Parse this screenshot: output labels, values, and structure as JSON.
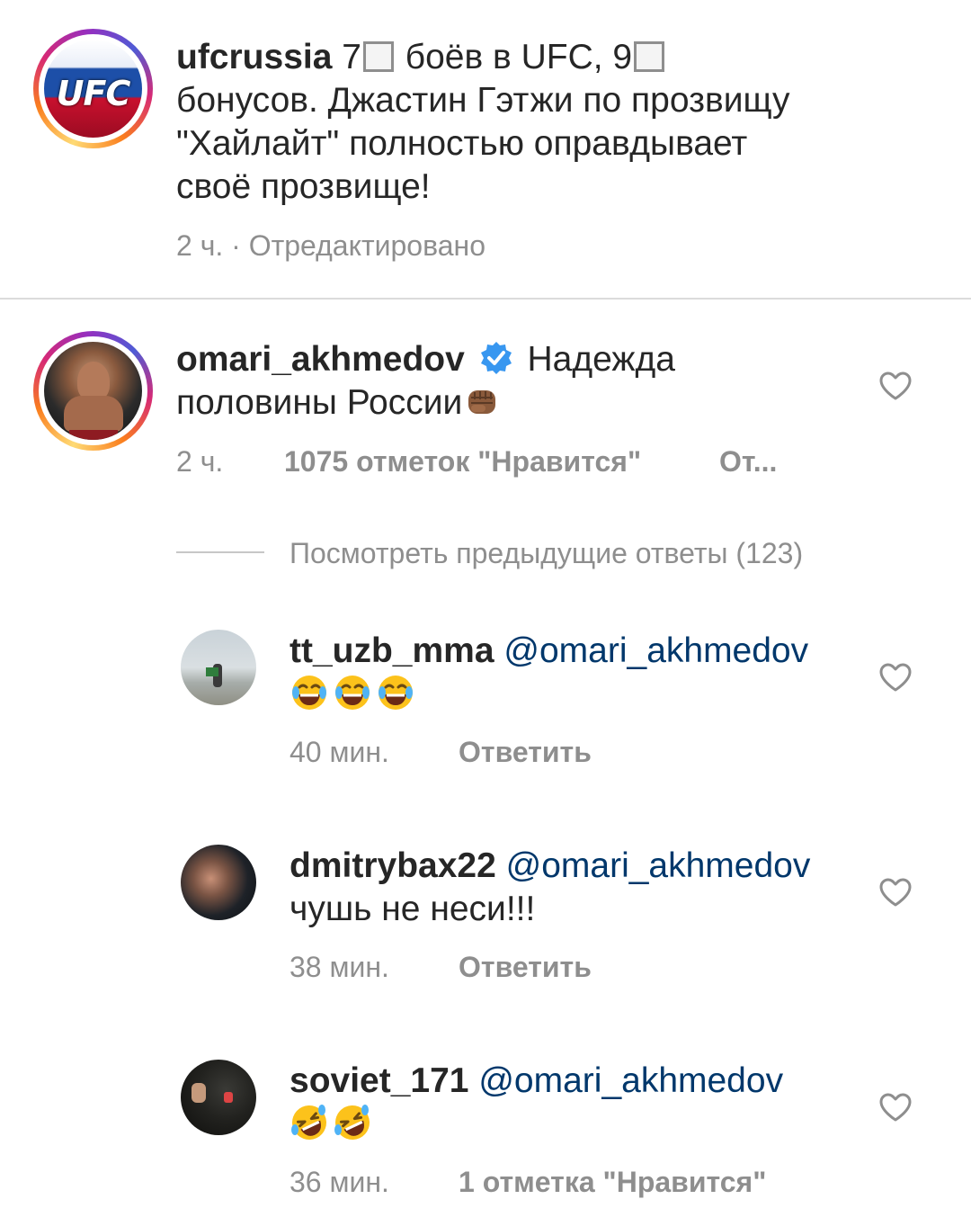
{
  "caption": {
    "username": "ufcrussia",
    "text_part1": " 7",
    "text_part2": " боёв в UFC, 9",
    "text_line2": "бонусов. Джастин Гэтжи по прозвищу",
    "text_line3": "\"Хайлайт\" полностью оправдывает",
    "text_line4": "своё прозвище!",
    "avatar_text": "UFC",
    "meta": "2 ч. · Отредактировано"
  },
  "comment": {
    "username": "omari_akhmedov",
    "text_line1": " Надежда",
    "text_line2": "половины России",
    "time": "2 ч.",
    "likes": "1075 отметок \"Нравится\"",
    "reply_truncated": "От..."
  },
  "view_previous": "Посмотреть предыдущие ответы (123)",
  "replies": [
    {
      "username": "tt_uzb_mma",
      "mention": "@omari_akhmedov",
      "time": "40 мин.",
      "action": "Ответить"
    },
    {
      "username": "dmitrybax22",
      "mention": "@omari_akhmedov",
      "text": "чушь не неси!!!",
      "time": "38 мин.",
      "action": "Ответить"
    },
    {
      "username": "soviet_171",
      "mention": "@omari_akhmedov",
      "time": "36 мин.",
      "action": "1 отметка \"Нравится\""
    }
  ],
  "icons": {
    "heart": "heart-outline-icon",
    "verified": "verified-badge-icon",
    "fist": "fist-emoji",
    "tears_of_joy": "face-with-tears-of-joy-emoji",
    "rofl": "rolling-on-floor-laughing-emoji"
  },
  "colors": {
    "text": "#262626",
    "meta": "#8e8e8e",
    "mention": "#00376b",
    "verified": "#3897f0",
    "divider": "#dbdbdb"
  }
}
